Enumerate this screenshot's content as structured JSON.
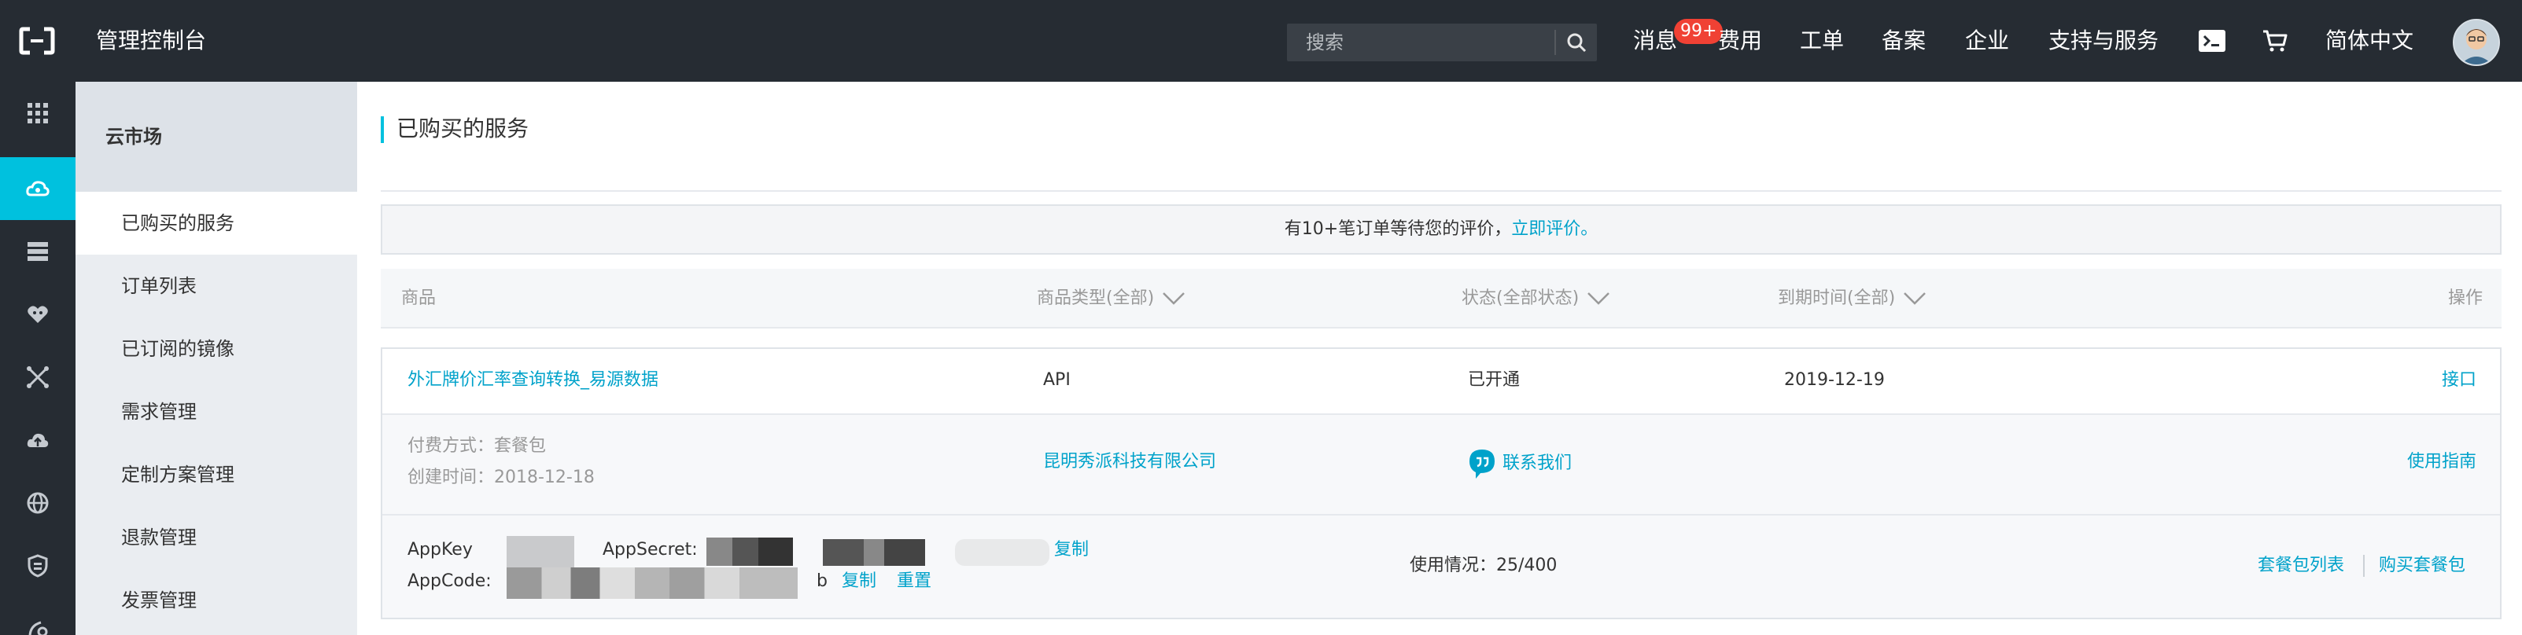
{
  "topbar": {
    "console_title": "管理控制台",
    "search_placeholder": "搜索",
    "nav": {
      "messages": "消息",
      "messages_badge": "99+",
      "billing": "费用",
      "tickets": "工单",
      "filing": "备案",
      "enterprise": "企业",
      "support": "支持与服务",
      "language": "简体中文"
    }
  },
  "rail": {
    "items": [
      "apps-grid-icon",
      "cloud-market-icon",
      "database-icon",
      "brain-icon",
      "network-icon",
      "cloud-upload-icon",
      "globe-icon",
      "shield-icon",
      "more-icon"
    ]
  },
  "sidebar": {
    "title": "云市场",
    "items": [
      {
        "label": "已购买的服务"
      },
      {
        "label": "订单列表"
      },
      {
        "label": "已订阅的镜像"
      },
      {
        "label": "需求管理"
      },
      {
        "label": "定制方案管理"
      },
      {
        "label": "退款管理"
      },
      {
        "label": "发票管理"
      }
    ]
  },
  "main": {
    "page_title": "已购买的服务",
    "notice": {
      "text": "有10+笔订单等待您的评价，",
      "link": "立即评价。"
    },
    "table": {
      "headers": {
        "product": "商品",
        "type": "商品类型(全部)",
        "status": "状态(全部状态)",
        "expiry": "到期时间(全部)",
        "actions": "操作"
      },
      "order": {
        "product_name": "外汇牌价汇率查询转换_易源数据",
        "type": "API",
        "status": "已开通",
        "expiry": "2019-12-19",
        "action_api": "接口",
        "payment_method": "付费方式：套餐包",
        "created_time": "创建时间：2018-12-18",
        "vendor": "昆明秀派科技有限公司",
        "contact": "联系我们",
        "guide": "使用指南",
        "appkey_label": "AppKey",
        "appsecret_label": "AppSecret:",
        "copy_1": "复制",
        "appcode_label": "AppCode:",
        "appcode_suffix": "b",
        "copy_2": "复制",
        "reset": "重置",
        "usage": "使用情况：25/400",
        "package_list": "套餐包列表",
        "buy_package": "购买套餐包"
      }
    }
  },
  "colors": {
    "topbar_bg": "#262c33",
    "accent": "#00c1de",
    "link": "#00a2ca",
    "badge": "#f04134",
    "sidebar_bg": "#eaedf1"
  }
}
